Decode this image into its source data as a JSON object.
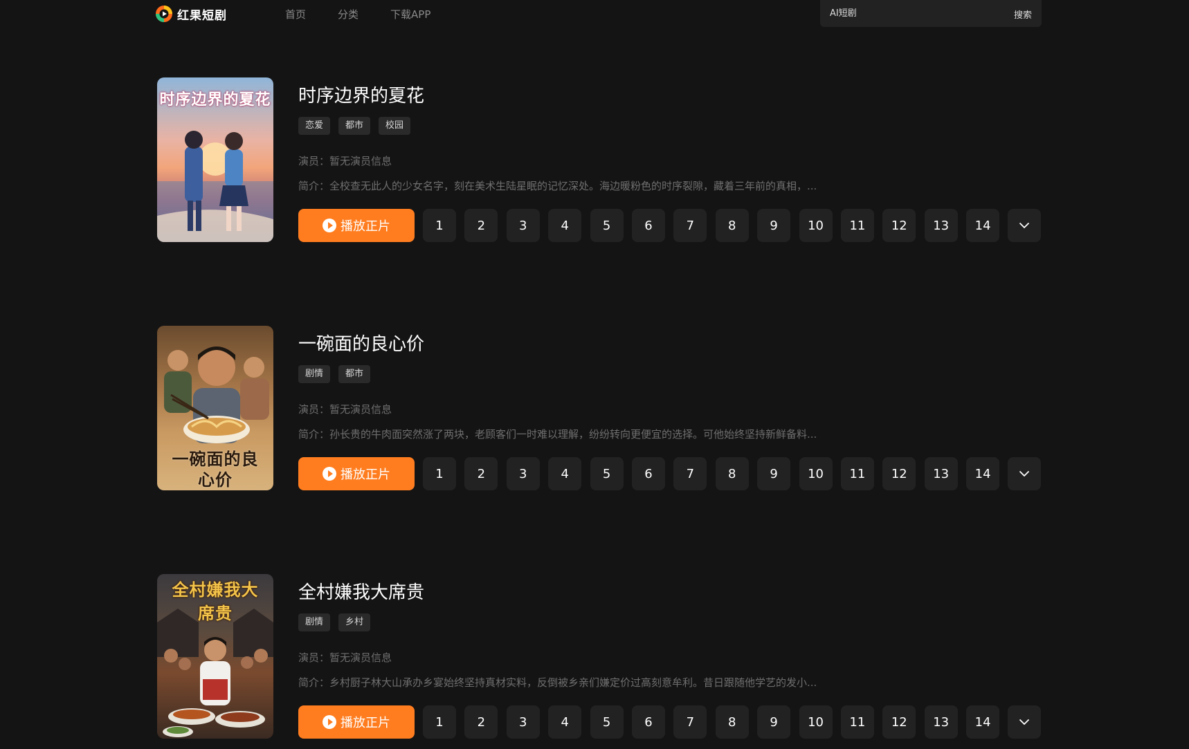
{
  "header": {
    "logo_text": "红果短剧",
    "nav": [
      "首页",
      "分类",
      "下载APP"
    ],
    "search": {
      "placeholder": "AI短剧",
      "button_label": "搜索"
    }
  },
  "dramas": [
    {
      "title": "时序边界的夏花",
      "poster_text": "时序边界的夏花",
      "tags": [
        "恋爱",
        "都市",
        "校园"
      ],
      "actors": "演员：暂无演员信息",
      "synopsis": "简介：全校查无此人的少女名字，刻在美术生陆星眠的记忆深处。海边暖粉色的时序裂隙，藏着三年前的真相，...",
      "play_label": "播放正片",
      "episodes": [
        "1",
        "2",
        "3",
        "4",
        "5",
        "6",
        "7",
        "8",
        "9",
        "10",
        "11",
        "12",
        "13",
        "14"
      ]
    },
    {
      "title": "一碗面的良心价",
      "poster_text": "一碗面的良心价",
      "tags": [
        "剧情",
        "都市"
      ],
      "actors": "演员：暂无演员信息",
      "synopsis": "简介：孙长贵的牛肉面突然涨了两块，老顾客们一时难以理解，纷纷转向更便宜的选择。可他始终坚持新鲜备料...",
      "play_label": "播放正片",
      "episodes": [
        "1",
        "2",
        "3",
        "4",
        "5",
        "6",
        "7",
        "8",
        "9",
        "10",
        "11",
        "12",
        "13",
        "14"
      ]
    },
    {
      "title": "全村嫌我大席贵",
      "poster_text": "全村嫌我大席贵",
      "tags": [
        "剧情",
        "乡村"
      ],
      "actors": "演员：暂无演员信息",
      "synopsis": "简介：乡村厨子林大山承办乡宴始终坚持真材实料，反倒被乡亲们嫌定价过高刻意牟利。昔日跟随他学艺的发小...",
      "play_label": "播放正片",
      "episodes": [
        "1",
        "2",
        "3",
        "4",
        "5",
        "6",
        "7",
        "8",
        "9",
        "10",
        "11",
        "12",
        "13",
        "14"
      ]
    }
  ],
  "colors": {
    "background": "#141414",
    "accent": "#ff7d1f",
    "chip": "#222222"
  },
  "icons": {
    "play": "play-circle-icon",
    "more": "chevron-down-icon",
    "logo": "play-logo-icon"
  }
}
